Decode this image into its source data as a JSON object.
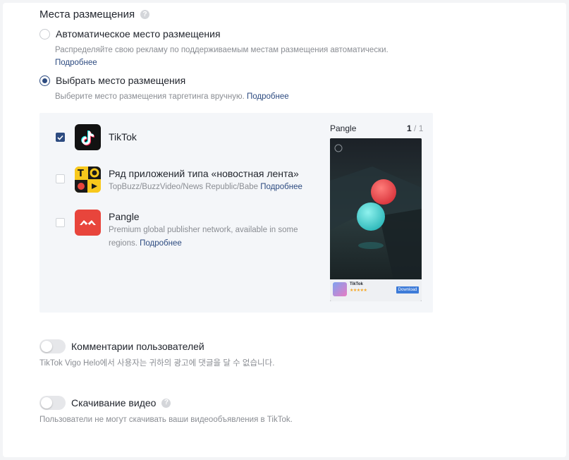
{
  "placements": {
    "title": "Места размещения",
    "auto": {
      "label": "Автоматическое место размещения",
      "hint": "Распределяйте свою рекламу по поддерживаемым местам размещения автоматически.",
      "more": "Подробнее"
    },
    "manual": {
      "label": "Выбрать место размещения",
      "hint": "Выберите место размещения таргетинга вручную.",
      "more": "Подробнее"
    },
    "apps": [
      {
        "name": "TikTok",
        "checked": true,
        "icon": "tiktok-icon"
      },
      {
        "name": "Ряд приложений типа «новостная лента»",
        "desc": "TopBuzz/BuzzVideo/News Republic/Babe",
        "more": "Подробнее",
        "checked": false,
        "icon": "topbuzz-icon"
      },
      {
        "name": "Pangle",
        "desc_line1": "Premium global publisher network, available in some",
        "desc_line2": "regions.",
        "more": "Подробнее",
        "checked": false,
        "icon": "pangle-icon"
      }
    ],
    "preview": {
      "label": "Pangle",
      "page_current": "1",
      "page_total": "/ 1",
      "ad_app": "TikTok",
      "ad_button": "Download"
    }
  },
  "comments": {
    "label": "Комментарии пользователей",
    "hint": "TikTok Vigo Helo에서 사용자는 귀하의 광고에 댓글을 달 수 없습니다.",
    "enabled": false
  },
  "download": {
    "label": "Скачивание видео",
    "hint": "Пользователи не могут скачивать ваши видеообъявления в TikTok.",
    "enabled": false
  },
  "colors": {
    "accent": "#2d4b80",
    "pangle_red": "#e8453c",
    "topbuzz_yellow": "#f8c81c"
  }
}
